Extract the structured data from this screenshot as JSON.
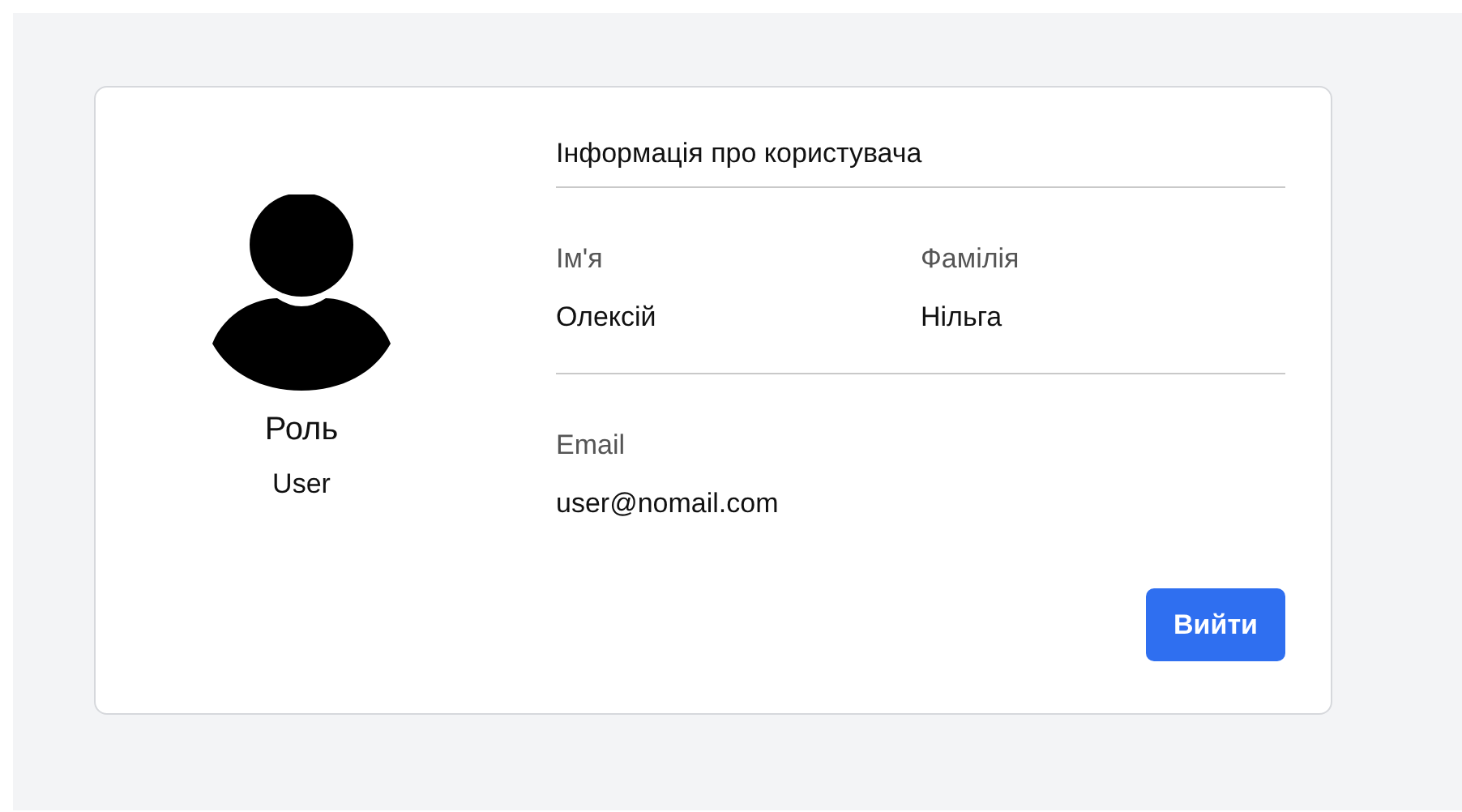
{
  "profile": {
    "role_label": "Роль",
    "role": "User"
  },
  "section_title": "Інформація про користувача",
  "name_fields": [
    {
      "label": "Ім'я",
      "value": "Олексій"
    },
    {
      "label": "Фамілія",
      "value": "Нільга"
    }
  ],
  "email_field": {
    "label": "Email",
    "value": "user@nomail.com"
  },
  "logout_button": "Вийти"
}
